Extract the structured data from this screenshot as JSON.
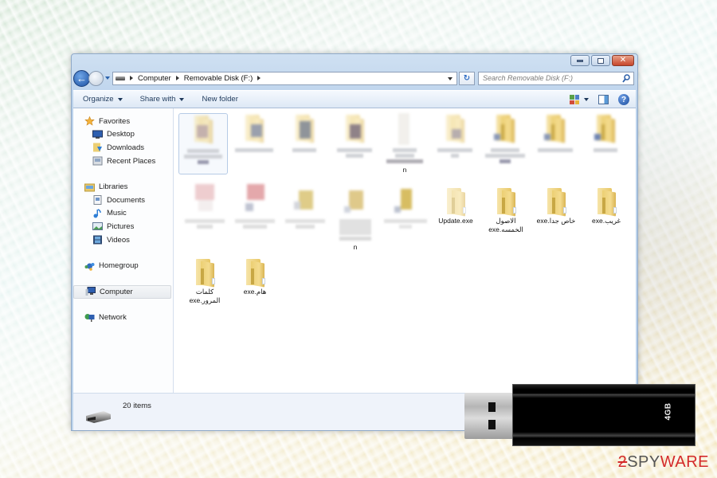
{
  "window": {
    "controls": {
      "minimize": "minimize",
      "maximize": "maximize",
      "close": "✕"
    }
  },
  "address": {
    "breadcrumbs": [
      "Computer",
      "Removable Disk (F:)"
    ],
    "refresh_glyph": "↻",
    "search_placeholder": "Search Removable Disk (F:)"
  },
  "commands": {
    "organize": "Organize",
    "share_with": "Share with",
    "new_folder": "New folder",
    "help_glyph": "?"
  },
  "sidebar": {
    "favorites": {
      "label": "Favorites",
      "items": [
        "Desktop",
        "Downloads",
        "Recent Places"
      ]
    },
    "libraries": {
      "label": "Libraries",
      "items": [
        "Documents",
        "Music",
        "Pictures",
        "Videos"
      ]
    },
    "homegroup": "Homegroup",
    "computer": "Computer",
    "network": "Network"
  },
  "files": {
    "blurred_row1_count": 9,
    "blurred_row2_count": 5,
    "stray_labels": [
      "n",
      "n"
    ],
    "visible": [
      {
        "name": "Update.exe",
        "type": "folder",
        "faded": true
      },
      {
        "name": "الاصول الخمسه.exe",
        "type": "folder",
        "faded": false
      },
      {
        "name": "خاص جدا.exe",
        "type": "folder",
        "faded": false
      },
      {
        "name": "غريب.exe",
        "type": "folder",
        "faded": false
      },
      {
        "name": "كلمات المرور.exe",
        "type": "folder",
        "faded": false
      },
      {
        "name": "هام.exe",
        "type": "folder",
        "faded": false
      }
    ]
  },
  "status": {
    "item_count": "20 items"
  },
  "overlay": {
    "usb_label": "4GB",
    "watermark": {
      "part1": "2",
      "part2": "SPY",
      "part3": "WAR",
      "part4": "E"
    }
  }
}
